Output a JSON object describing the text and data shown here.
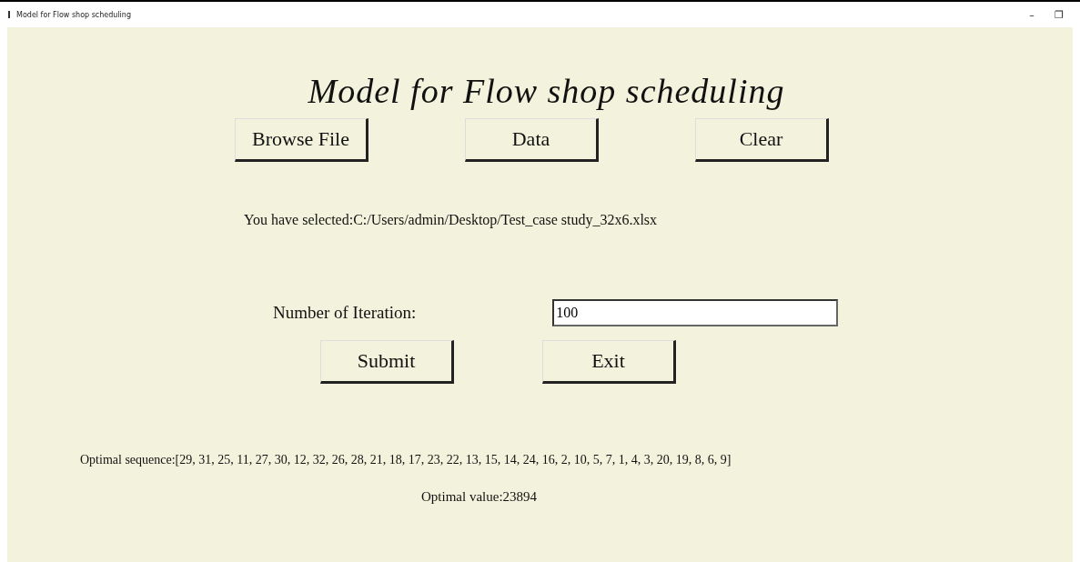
{
  "window": {
    "title": "Model for Flow shop scheduling",
    "controls": [
      "–",
      "❐"
    ]
  },
  "heading": "Model for Flow shop scheduling",
  "top_buttons": [
    "Browse File",
    "Data",
    "Clear"
  ],
  "selected_file": "You have selected:C:/Users/admin/Desktop/Test_case study_32x6.xlsx",
  "iterations": {
    "label": "Number of Iteration:",
    "value": "100"
  },
  "actions": [
    "Submit",
    "Exit"
  ],
  "result": {
    "sequence": "Optimal sequence:[29, 31, 25, 11, 27, 30, 12, 32, 26, 28, 21, 18, 17, 23, 22, 13, 15, 14, 24, 16, 2, 10, 5, 7, 1, 4, 3, 20, 19, 8, 6, 9]",
    "value": "Optimal value:23894"
  }
}
